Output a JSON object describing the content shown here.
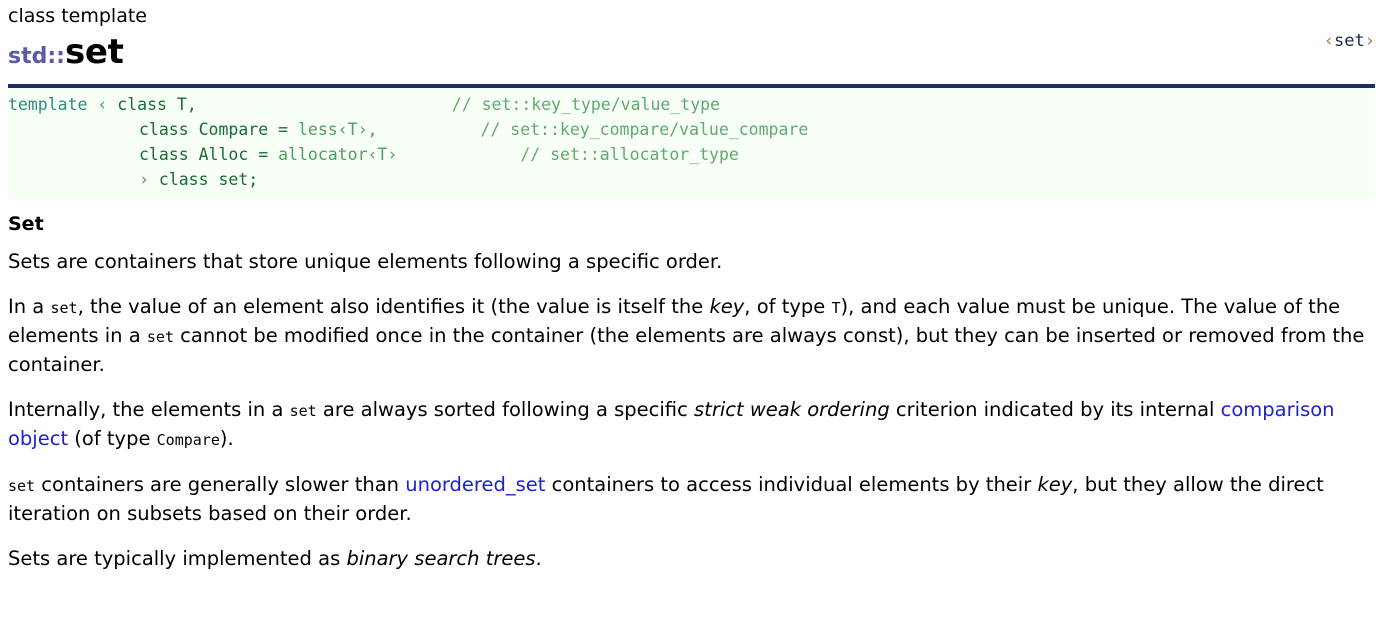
{
  "header": {
    "kicker": "class template",
    "namespace": "std::",
    "name": "set",
    "include_open": "‹",
    "include_name": "set",
    "include_close": "›",
    "include_full": "<set>",
    "rule_color": "#1b3060"
  },
  "code": {
    "l1_kw": "template",
    "l1_angle": "‹",
    "l1_class": "class",
    "l1_t": "T,",
    "l1_comment": "// set::key_type/value_type",
    "l2_class": "class",
    "l2_name": "Compare",
    "l2_eq": "=",
    "l2_val": "less‹T›,",
    "l2_comment": "// set::key_compare/value_compare",
    "l3_class": "class",
    "l3_name": "Alloc",
    "l3_eq": "=",
    "l3_val": "allocator‹T›",
    "l3_comment": "// set::allocator_type",
    "l4_angle": "›",
    "l4_class": "class",
    "l4_name": "set;"
  },
  "section": {
    "heading": "Set"
  },
  "paragraphs": {
    "p1": "Sets are containers that store unique elements following a specific order.",
    "p2_a": "In a ",
    "p2_code1": "set",
    "p2_b": ", the value of an element also identifies it (the value is itself the ",
    "p2_em1": "key",
    "p2_c": ", of type ",
    "p2_code2": "T",
    "p2_d": "), and each value must be unique. The value of the elements in a ",
    "p2_code3": "set",
    "p2_e": " cannot be modified once in the container (the elements are always const), but they can be inserted or removed from the container.",
    "p3_a": "Internally, the elements in a ",
    "p3_code1": "set",
    "p3_b": " are always sorted following a specific ",
    "p3_em1": "strict weak ordering",
    "p3_c": " criterion indicated by its internal ",
    "p3_link1": "comparison object",
    "p3_d": " (of type ",
    "p3_code2": "Compare",
    "p3_e": ").",
    "p4_code1": "set",
    "p4_a": " containers are generally slower than ",
    "p4_link1": "unordered_set",
    "p4_b": " containers to access individual elements by their ",
    "p4_em1": "key",
    "p4_c": ", but they allow the direct iteration on subsets based on their order.",
    "p5_a": "Sets are typically implemented as ",
    "p5_em1": "binary search trees",
    "p5_b": "."
  },
  "colors": {
    "namespace": "#5a5aa5",
    "link": "#1d22cc",
    "code_bg": "#f7fff7",
    "code_text": "#1a6b34",
    "code_comment": "#5faa6d",
    "code_keyword": "#2e8a7a",
    "rule": "#1b3060",
    "include_angle": "#b2763c"
  }
}
